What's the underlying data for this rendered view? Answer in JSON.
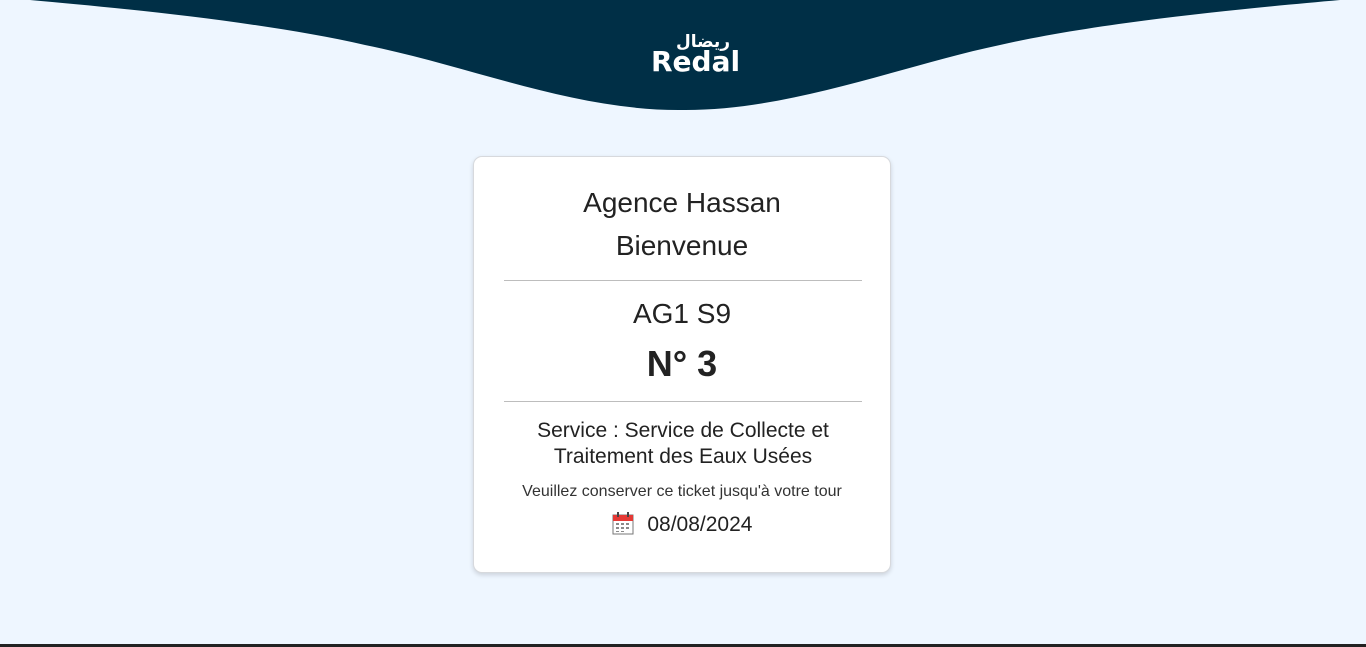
{
  "brand": {
    "name_latin": "Redal",
    "name_arabic": "ريضال"
  },
  "ticket": {
    "agency": "Agence Hassan",
    "welcome": "Bienvenue",
    "code": "AG1 S9",
    "number": "N° 3",
    "service": "Service : Service de Collecte et Traitement des Eaux Usées",
    "instruction": "Veuillez conserver ce ticket jusqu'à votre tour",
    "date": "08/08/2024",
    "date_icon": "calendar-icon"
  },
  "colors": {
    "header": "#002f46",
    "background": "#eef6ff",
    "card": "#ffffff",
    "text": "#222222"
  }
}
